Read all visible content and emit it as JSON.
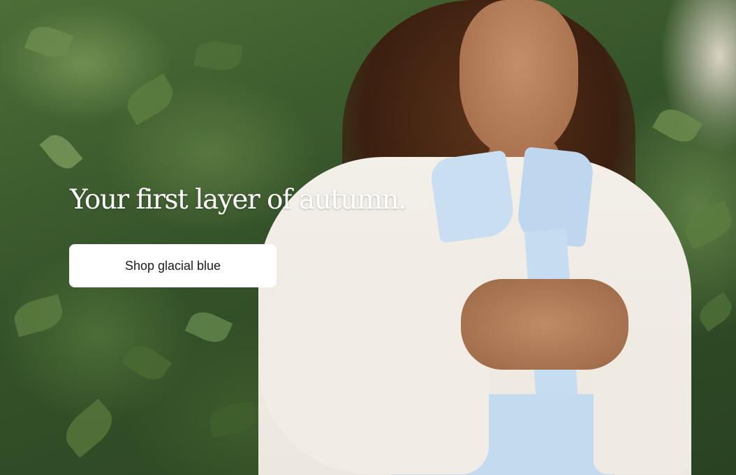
{
  "hero": {
    "headline": "Your first layer of autumn.",
    "cta_label": "Shop glacial blue",
    "image_description_icon": "model-photo",
    "colors": {
      "headline_text": "#ffffff",
      "cta_background": "#ffffff",
      "cta_text": "#1a1a1a",
      "foliage": "#3d5c2c",
      "jacket_blue": "#c3daef",
      "jacket_cream": "#f3efe9"
    }
  }
}
